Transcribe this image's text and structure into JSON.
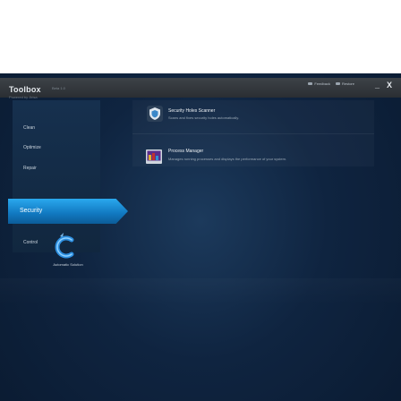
{
  "window": {
    "title": "Toolbox",
    "version": "Beta 1.0",
    "subtitle": "Powered by Jirisa"
  },
  "top_links": [
    {
      "label": "Feedback",
      "icon": "message-icon"
    },
    {
      "label": "Restore",
      "icon": "restore-icon"
    }
  ],
  "controls": {
    "minimize": "_",
    "close": "X"
  },
  "sidebar": {
    "items": [
      {
        "label": "Clean"
      },
      {
        "label": "Optimize"
      },
      {
        "label": "Repair"
      },
      {
        "label": "Security",
        "active": true
      },
      {
        "label": "Control"
      }
    ]
  },
  "tools": [
    {
      "title": "Security Holes Scanner",
      "desc": "Scans and fixes security holes automatically.",
      "icon": "shield-icon"
    },
    {
      "title": "Process Manager",
      "desc": "Manages running processes and displays the performance of your system.",
      "icon": "process-manager-icon"
    }
  ],
  "logo": {
    "label": "Automatic Solution",
    "icon": "c-logo-icon"
  },
  "colors": {
    "accent": "#1a8fdc",
    "background": "#0f2440",
    "titlebar": "#2f3439"
  }
}
